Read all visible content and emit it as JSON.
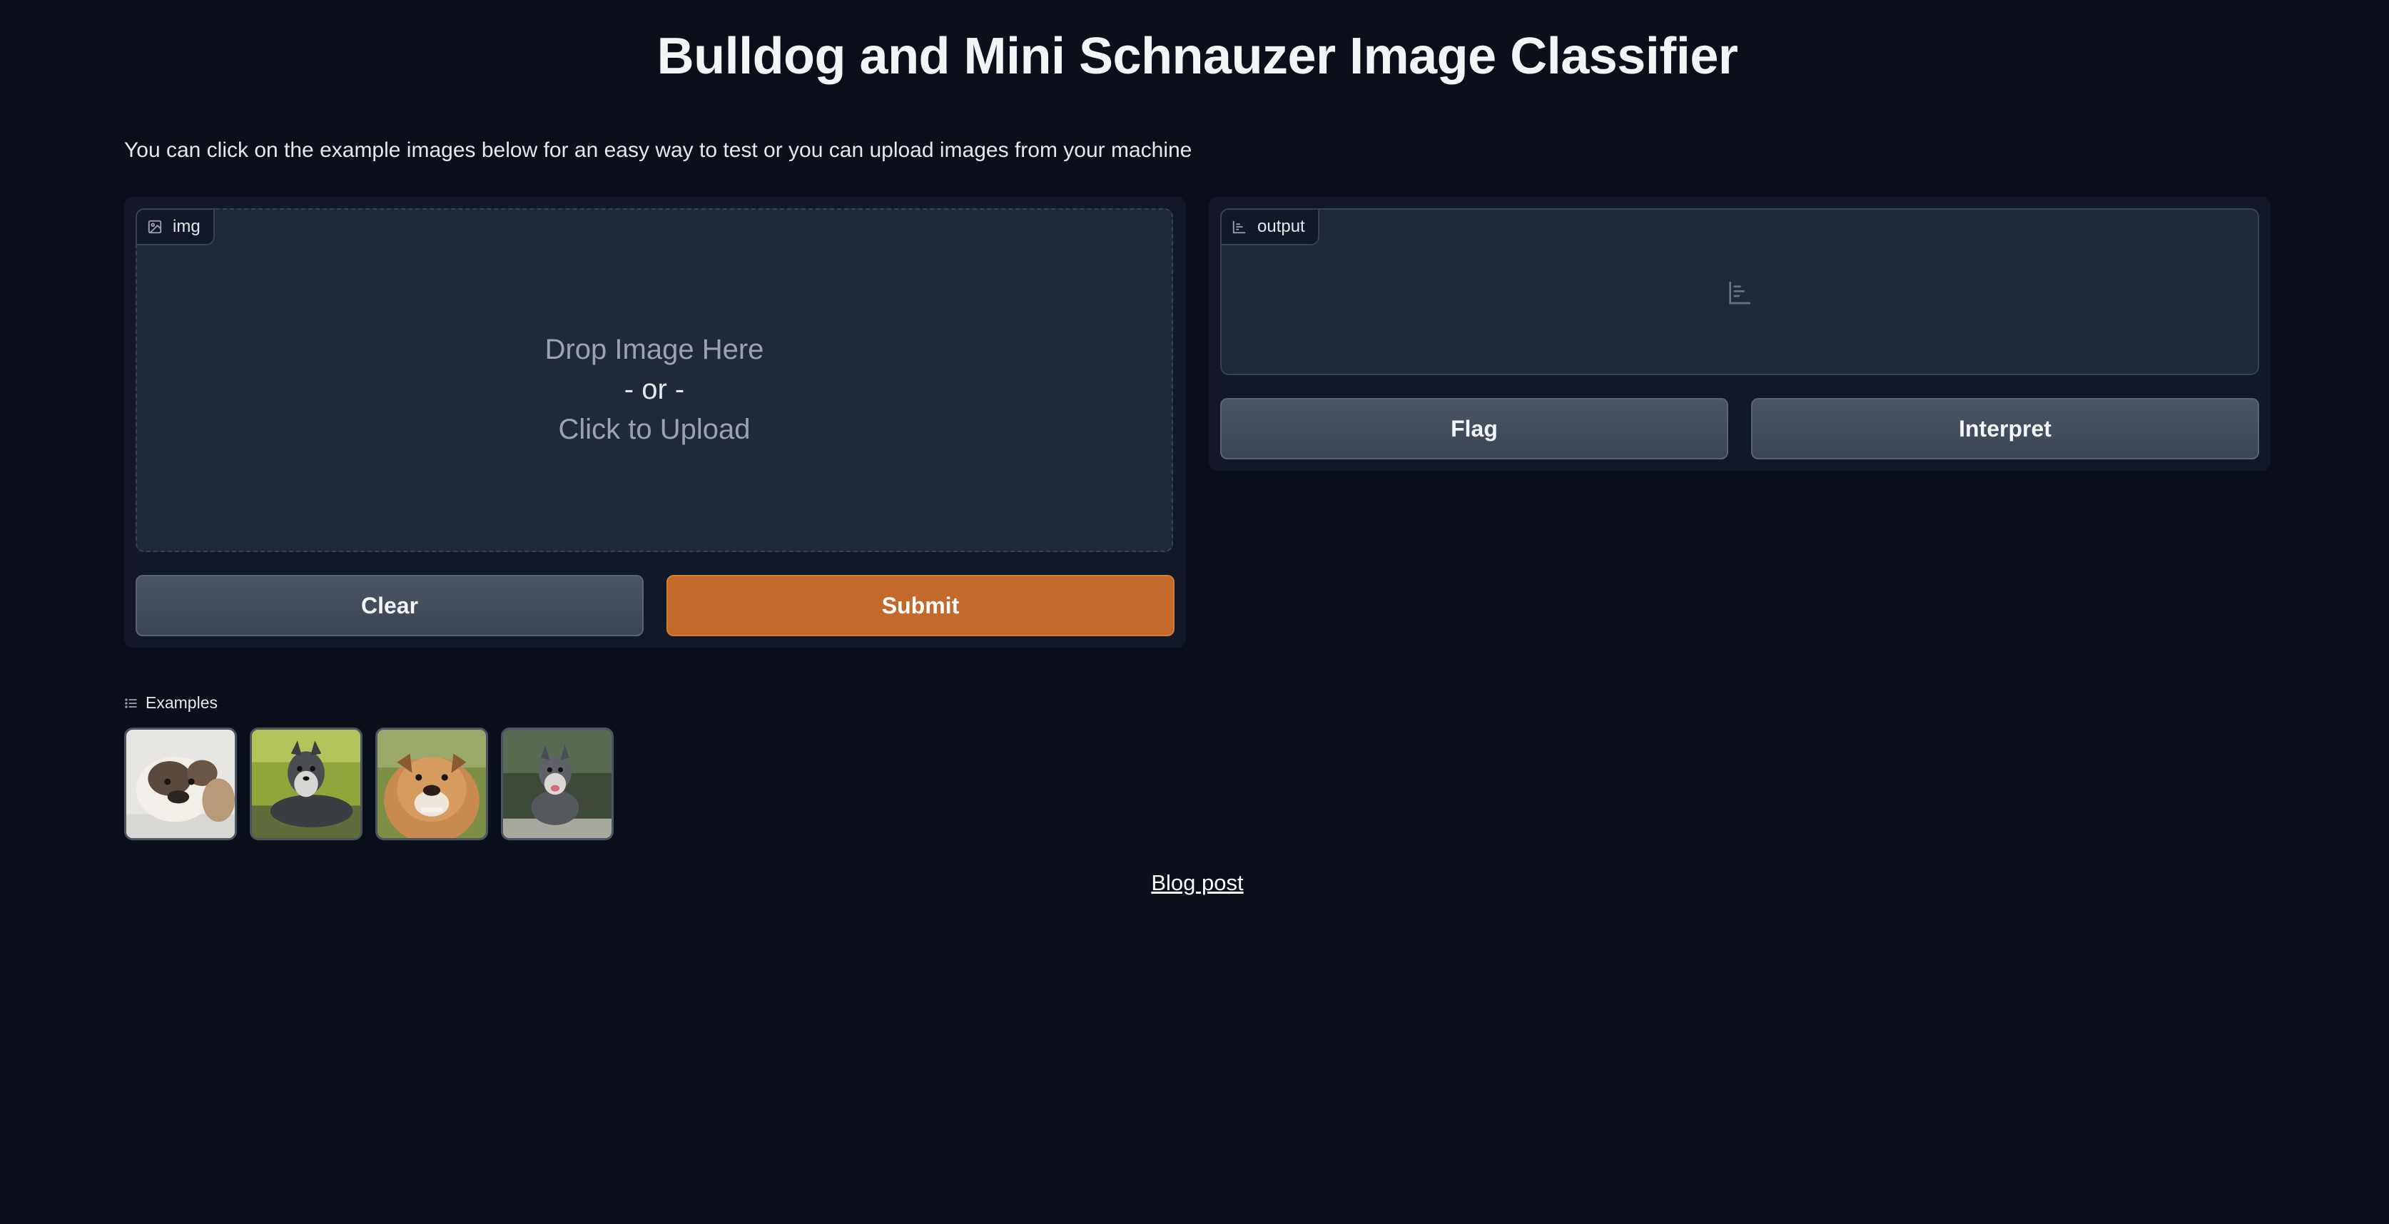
{
  "header": {
    "title": "Bulldog and Mini Schnauzer Image Classifier"
  },
  "description": "You can click on the example images below for an easy way to test or you can upload images from your machine",
  "input": {
    "label": "img",
    "label_icon": "image-icon",
    "drop_line1": "Drop Image Here",
    "drop_line2": "- or -",
    "drop_line3": "Click to Upload"
  },
  "output": {
    "label": "output",
    "label_icon": "bar-chart-icon"
  },
  "buttons": {
    "clear": "Clear",
    "submit": "Submit",
    "flag": "Flag",
    "interpret": "Interpret"
  },
  "examples": {
    "label": "Examples",
    "label_icon": "list-icon",
    "items": [
      {
        "subject": "bulldog",
        "icon": "bulldog-photo"
      },
      {
        "subject": "mini schnauzer",
        "icon": "schnauzer-photo"
      },
      {
        "subject": "bulldog",
        "icon": "bulldog-photo"
      },
      {
        "subject": "mini schnauzer",
        "icon": "schnauzer-photo"
      }
    ]
  },
  "footer": {
    "link": "Blog post"
  },
  "colors": {
    "background": "#0b0f19",
    "panel": "#111827",
    "block": "#1f2937",
    "primary": "#c2692b",
    "secondary": "#4b5563"
  }
}
